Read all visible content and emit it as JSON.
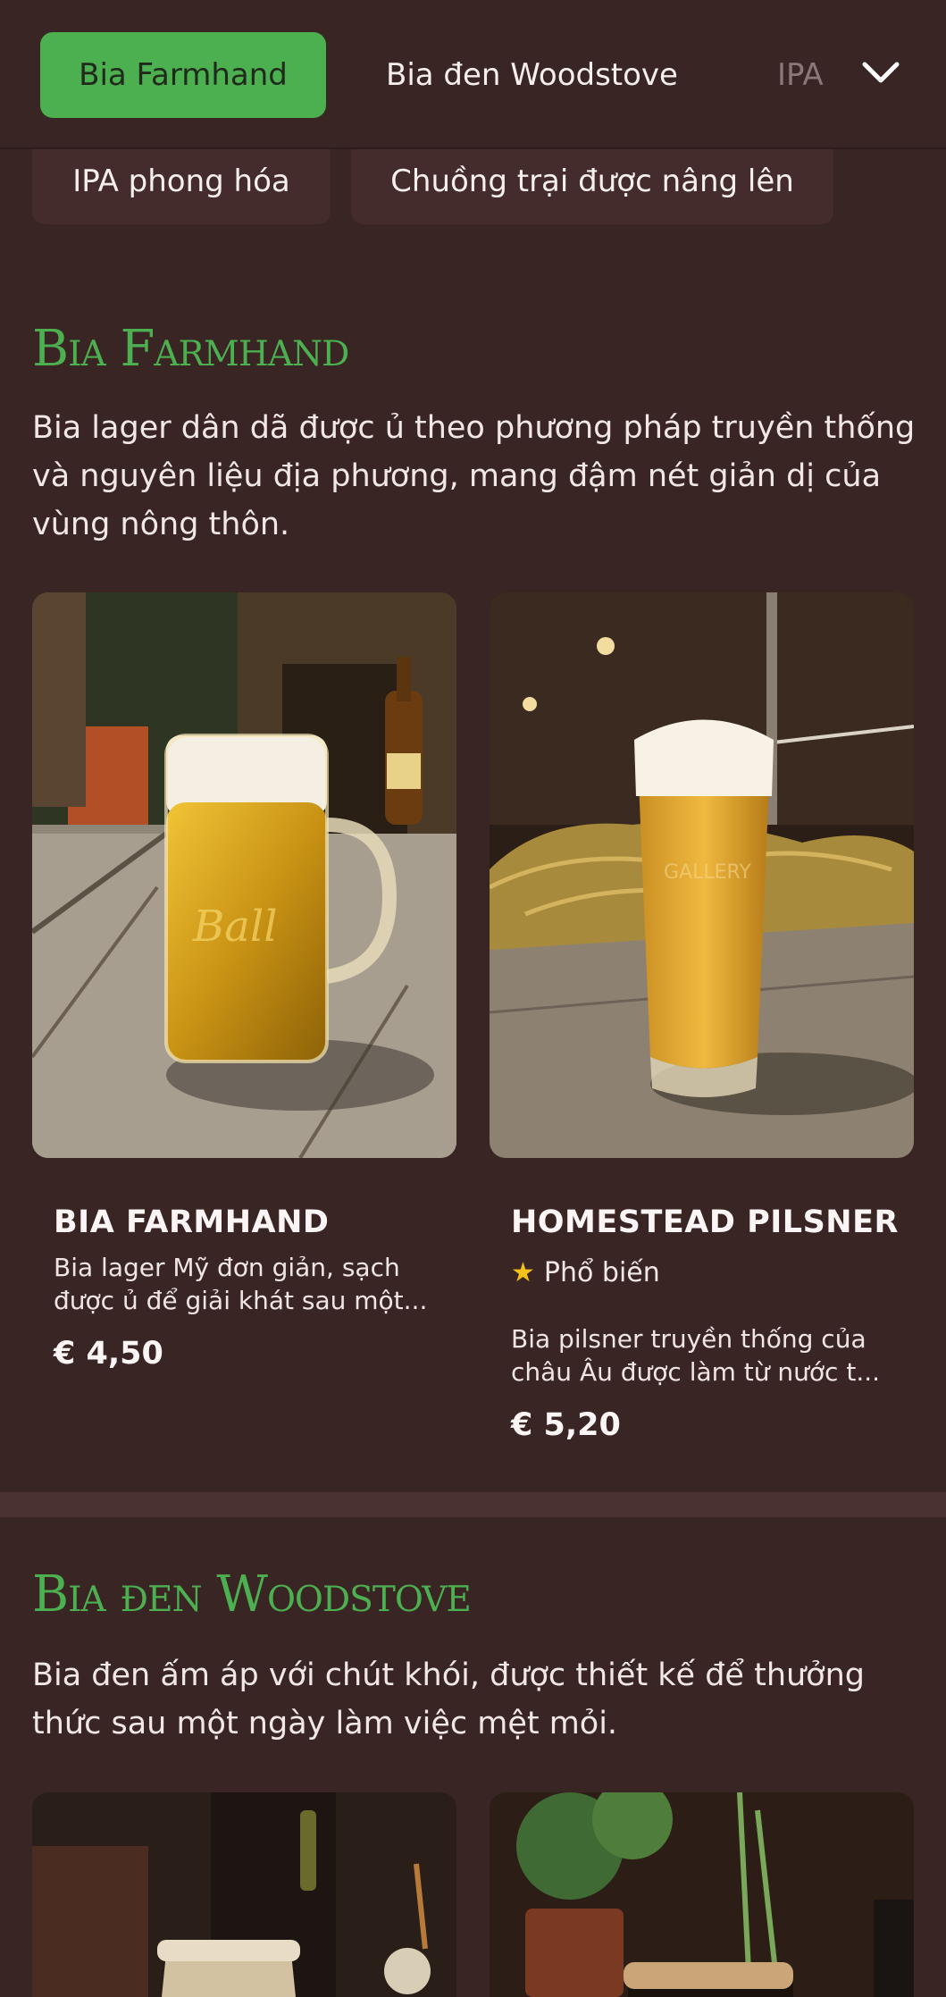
{
  "nav": {
    "tabs": [
      "Bia Farmhand",
      "Bia đen Woodstove",
      "IPA"
    ],
    "active_tab": "Bia Farmhand",
    "chips": [
      "IPA phong hóa",
      "Chuồng trại được nâng lên"
    ]
  },
  "sections": [
    {
      "title": "Bia Farmhand",
      "description": "Bia lager dân dã được ủ theo phương pháp truyền thống và nguyên liệu địa phương, mang đậm nét giản dị của vùng nông thôn.",
      "items": [
        {
          "name": "BIA FARMHAND",
          "desc_line1": "Bia lager Mỹ đơn giản, sạch",
          "desc_line2": "được ủ để giải khát sau một...",
          "price": "€ 4,50"
        },
        {
          "name": "HOMESTEAD PILSNER",
          "badge": "Phổ biến",
          "desc_line1": "Bia pilsner truyền thống của",
          "desc_line2": "châu Âu được làm từ nước t...",
          "price": "€ 5,20"
        }
      ]
    },
    {
      "title": "Bia đen Woodstove",
      "description": "Bia đen ấm áp với chút khói, được thiết kế để thưởng thức sau một ngày làm việc mệt mỏi."
    }
  ],
  "icons": {
    "dropdown": "chevron-down-icon",
    "popular": "star-icon"
  },
  "colors": {
    "background": "#3a2525",
    "accent": "#4caf50",
    "star": "#f3c21a"
  }
}
